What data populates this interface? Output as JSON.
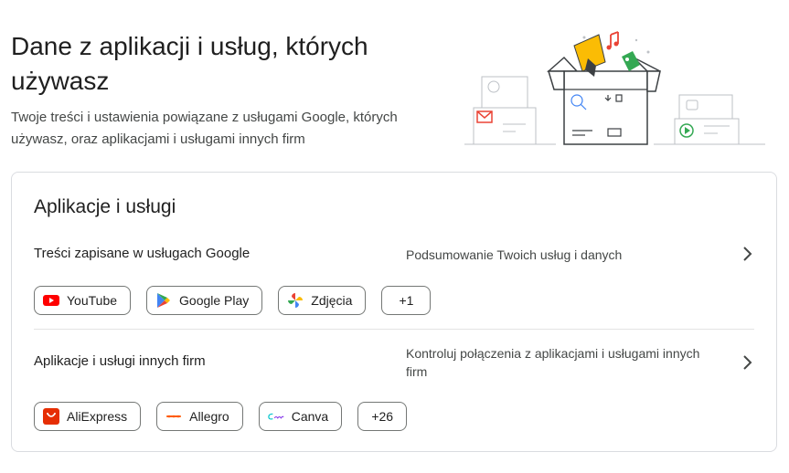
{
  "header": {
    "title": "Dane z aplikacji i usług, których używasz",
    "subtitle": "Twoje treści i ustawienia powiązane z usługami Google, których używasz, oraz aplikacjami i usługami innych firm"
  },
  "card": {
    "title": "Aplikacje i usługi",
    "sections": [
      {
        "label": "Treści zapisane w usługach Google",
        "description": "Podsumowanie Twoich usług i danych",
        "chips": [
          {
            "label": "YouTube",
            "icon": "youtube-icon"
          },
          {
            "label": "Google Play",
            "icon": "google-play-icon"
          },
          {
            "label": "Zdjęcia",
            "icon": "google-photos-icon"
          }
        ],
        "more": "+1"
      },
      {
        "label": "Aplikacje i usługi innych firm",
        "description": "Kontroluj połączenia z aplikacjami i usługami innych firm",
        "chips": [
          {
            "label": "AliExpress",
            "icon": "aliexpress-icon"
          },
          {
            "label": "Allegro",
            "icon": "allegro-icon"
          },
          {
            "label": "Canva",
            "icon": "canva-icon"
          }
        ],
        "more": "+26"
      }
    ]
  },
  "icons": {
    "chevron": "chevron-right-icon"
  },
  "colors": {
    "youtube": "#ff0000",
    "aliexpress": "#e62e04",
    "allegro": "#ff5a00",
    "canva": "#00c4cc",
    "border": "#dadce0",
    "text_secondary": "#444746"
  }
}
